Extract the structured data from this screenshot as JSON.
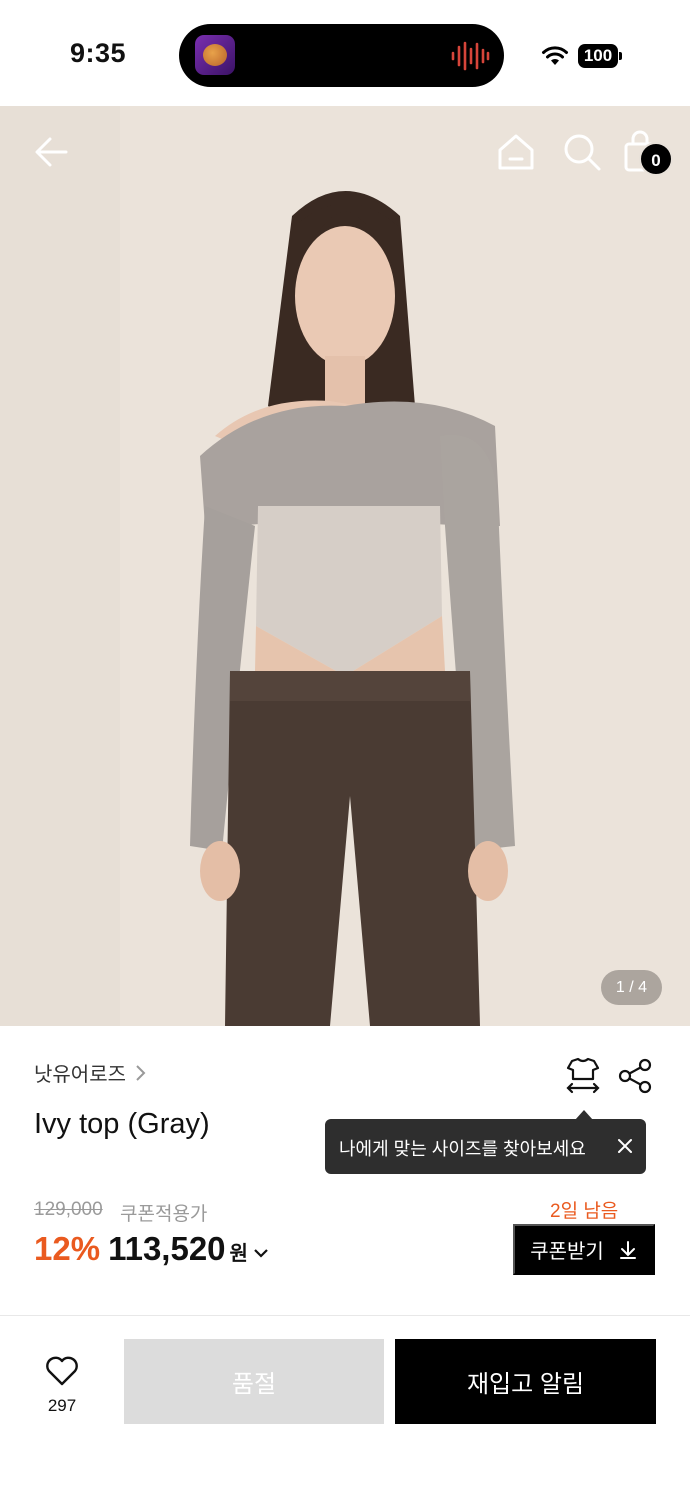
{
  "status_bar": {
    "time": "9:35",
    "battery": "100",
    "icons": [
      "app-icon",
      "audio-wave-icon",
      "wifi-icon",
      "battery-icon"
    ]
  },
  "hero": {
    "page_indicator": "1 / 4",
    "cart_count": "0",
    "icons": [
      "back-arrow-icon",
      "home-icon",
      "search-icon",
      "shopping-bag-icon"
    ]
  },
  "product": {
    "brand": "낫유어로즈",
    "name": "Ivy top (Gray)",
    "original_price": "129,000",
    "coupon_price_label": "쿠폰적용가",
    "discount": "12%",
    "price": "113,520",
    "currency": "원"
  },
  "tooltip": {
    "text": "나에게 맞는 사이즈를 찾아보세요"
  },
  "coupon": {
    "days_left": "2일 남음",
    "button_label": "쿠폰받기"
  },
  "bottom_bar": {
    "wish_count": "297",
    "soldout_label": "품절",
    "restock_label": "재입고 알림"
  },
  "colors": {
    "accent": "#ea5a1f",
    "primary_button": "#000000",
    "disabled_button": "#dcdcdc"
  }
}
